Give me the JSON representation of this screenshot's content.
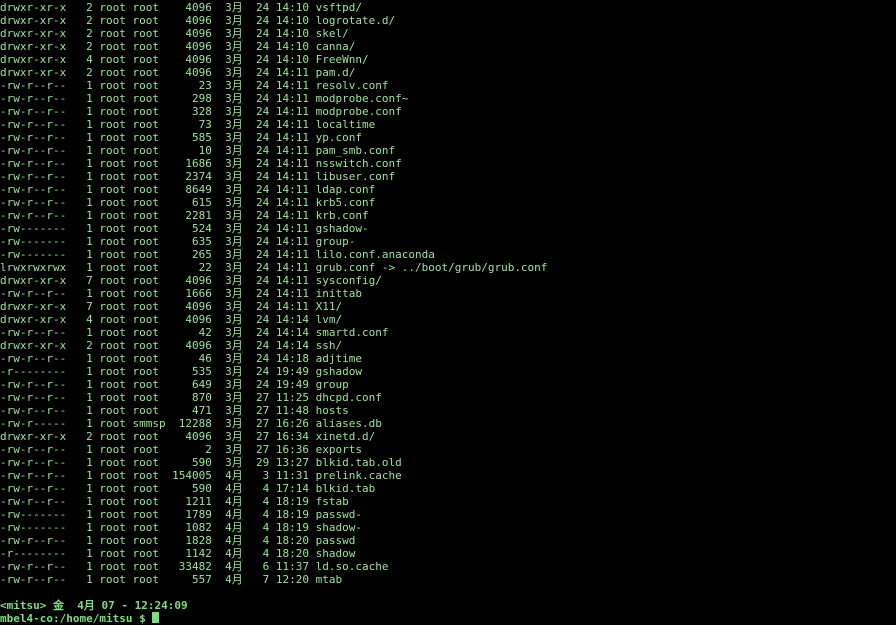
{
  "terminal": {
    "lines": [
      "drwxr-xr-x   2 root root    4096  3月  24 14:10 vsftpd/",
      "drwxr-xr-x   2 root root    4096  3月  24 14:10 logrotate.d/",
      "drwxr-xr-x   2 root root    4096  3月  24 14:10 skel/",
      "drwxr-xr-x   2 root root    4096  3月  24 14:10 canna/",
      "drwxr-xr-x   4 root root    4096  3月  24 14:10 FreeWnn/",
      "drwxr-xr-x   2 root root    4096  3月  24 14:11 pam.d/",
      "-rw-r--r--   1 root root      23  3月  24 14:11 resolv.conf",
      "-rw-r--r--   1 root root     298  3月  24 14:11 modprobe.conf~",
      "-rw-r--r--   1 root root     328  3月  24 14:11 modprobe.conf",
      "-rw-r--r--   1 root root      73  3月  24 14:11 localtime",
      "-rw-r--r--   1 root root     585  3月  24 14:11 yp.conf",
      "-rw-r--r--   1 root root      10  3月  24 14:11 pam_smb.conf",
      "-rw-r--r--   1 root root    1686  3月  24 14:11 nsswitch.conf",
      "-rw-r--r--   1 root root    2374  3月  24 14:11 libuser.conf",
      "-rw-r--r--   1 root root    8649  3月  24 14:11 ldap.conf",
      "-rw-r--r--   1 root root     615  3月  24 14:11 krb5.conf",
      "-rw-r--r--   1 root root    2281  3月  24 14:11 krb.conf",
      "-rw-------   1 root root     524  3月  24 14:11 gshadow-",
      "-rw-------   1 root root     635  3月  24 14:11 group-",
      "-rw-------   1 root root     265  3月  24 14:11 lilo.conf.anaconda",
      "lrwxrwxrwx   1 root root      22  3月  24 14:11 grub.conf -> ../boot/grub/grub.conf",
      "drwxr-xr-x   7 root root    4096  3月  24 14:11 sysconfig/",
      "-rw-r--r--   1 root root    1666  3月  24 14:11 inittab",
      "drwxr-xr-x   7 root root    4096  3月  24 14:11 X11/",
      "drwxr-xr-x   4 root root    4096  3月  24 14:14 lvm/",
      "-rw-r--r--   1 root root      42  3月  24 14:14 smartd.conf",
      "drwxr-xr-x   2 root root    4096  3月  24 14:14 ssh/",
      "-rw-r--r--   1 root root      46  3月  24 14:18 adjtime",
      "-r--------   1 root root     535  3月  24 19:49 gshadow",
      "-rw-r--r--   1 root root     649  3月  24 19:49 group",
      "-rw-r--r--   1 root root     870  3月  27 11:25 dhcpd.conf",
      "-rw-r--r--   1 root root     471  3月  27 11:48 hosts",
      "-rw-r-----   1 root smmsp  12288  3月  27 16:26 aliases.db",
      "drwxr-xr-x   2 root root    4096  3月  27 16:34 xinetd.d/",
      "-rw-r--r--   1 root root       2  3月  27 16:36 exports",
      "-rw-r--r--   1 root root     590  3月  29 13:27 blkid.tab.old",
      "-rw-r--r--   1 root root  154005  4月   3 11:31 prelink.cache",
      "-rw-r--r--   1 root root     590  4月   4 17:14 blkid.tab",
      "-rw-r--r--   1 root root    1211  4月   4 18:19 fstab",
      "-rw-------   1 root root    1789  4月   4 18:19 passwd-",
      "-rw-------   1 root root    1082  4月   4 18:19 shadow-",
      "-rw-r--r--   1 root root    1828  4月   4 18:20 passwd",
      "-r--------   1 root root    1142  4月   4 18:20 shadow",
      "-rw-r--r--   1 root root   33482  4月   6 11:37 ld.so.cache",
      "-rw-r--r--   1 root root     557  4月   7 12:20 mtab"
    ],
    "prompt_status": "<mitsu> 金  4月 07 - 12:24:09",
    "prompt_path": "mbel4-co:/home/mitsu $ ",
    "colors": {
      "background": "#000000",
      "text": "#9ee39e",
      "prompt": "#7fdc7f"
    }
  }
}
